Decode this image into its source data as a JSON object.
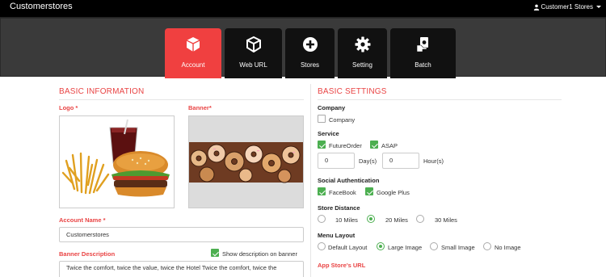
{
  "app": {
    "brand": "Customerstores",
    "user_menu": "Customer1 Stores"
  },
  "nav": {
    "tabs": [
      {
        "label": "Account",
        "icon": "cube-icon",
        "active": true
      },
      {
        "label": "Web URL",
        "icon": "cube-outline-icon",
        "active": false
      },
      {
        "label": "Stores",
        "icon": "plus-circle-icon",
        "active": false
      },
      {
        "label": "Setting",
        "icon": "gear-icon",
        "active": false
      },
      {
        "label": "Batch",
        "icon": "money-hand-icon",
        "active": false
      }
    ]
  },
  "basic_info": {
    "title": "BASIC INFORMATION",
    "logo_label": "Logo",
    "banner_label": "Banner*",
    "required_mark": "*",
    "account_name_label": "Account Name",
    "account_name_value": "Customerstores",
    "banner_desc_label": "Banner Description",
    "show_desc_label": "Show description on banner",
    "banner_desc_value": "Twice the comfort, twice the value, twice the Hotel Twice the comfort, twice the"
  },
  "basic_settings": {
    "title": "BASIC SETTINGS",
    "company": {
      "label": "Company",
      "option": "Company",
      "checked": false
    },
    "service": {
      "label": "Service",
      "options": [
        {
          "label": "FutureOrder",
          "checked": true
        },
        {
          "label": "ASAP",
          "checked": true
        }
      ],
      "days_value": "0",
      "days_label": "Day(s)",
      "hours_value": "0",
      "hours_label": "Hour(s)"
    },
    "social": {
      "label": "Social Authentication",
      "options": [
        {
          "label": "FaceBook",
          "checked": true
        },
        {
          "label": "Google Plus",
          "checked": true
        }
      ]
    },
    "distance": {
      "label": "Store Distance",
      "options": [
        "10 Miles",
        "20 Miles",
        "30 Miles"
      ],
      "selected": "20 Miles"
    },
    "menu_layout": {
      "label": "Menu Layout",
      "options": [
        "Default Layout",
        "Large Image",
        "Small Image",
        "No Image"
      ],
      "selected": "Large Image"
    },
    "app_store_url_label": "App Store's URL"
  },
  "colors": {
    "accent": "#f04040",
    "check": "#4caf50",
    "topbar": "#000000",
    "navband": "#3a3a3a"
  }
}
